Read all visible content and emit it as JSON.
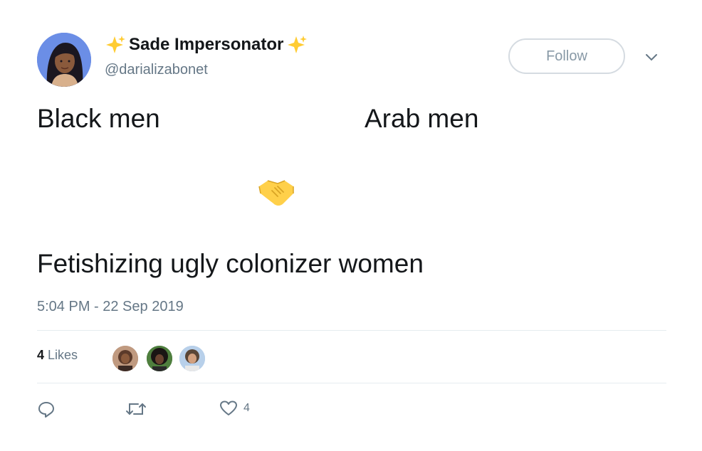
{
  "user": {
    "display_name": "Sade Impersonator",
    "handle": "@darializabonet",
    "avatar_icon": "avatar-illustration"
  },
  "follow_button": {
    "label": "Follow"
  },
  "menu_icon": "chevron-down-icon",
  "tweet": {
    "line_1_left": "Black men",
    "line_1_right": "Arab men",
    "emoji": "handshake",
    "line_2": "Fetishizing ugly colonizer women",
    "timestamp": "5:04 PM - 22 Sep 2019"
  },
  "stats": {
    "likes_count": "4",
    "likes_label": "Likes"
  },
  "actions": {
    "reply_icon": "reply-icon",
    "retweet_icon": "retweet-icon",
    "like_icon": "heart-icon",
    "like_count": "4"
  },
  "colors": {
    "text": "#14171a",
    "muted": "#657786",
    "border": "#e6ecf0",
    "sparkle": "#ffcc33",
    "handshake": "#ffd04a"
  }
}
